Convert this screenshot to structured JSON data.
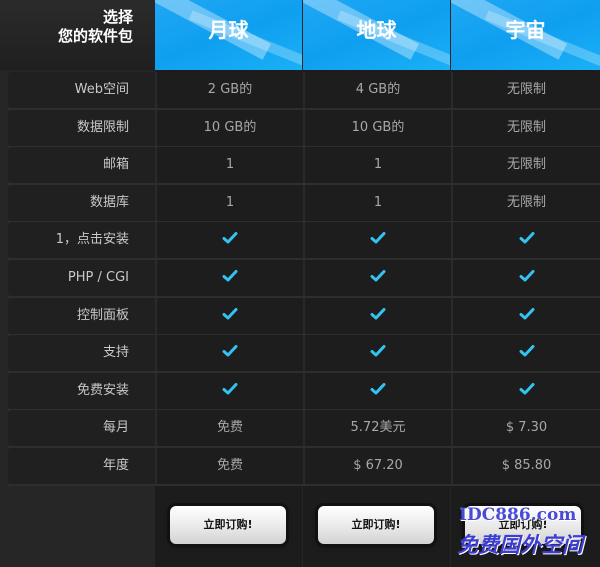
{
  "corner": {
    "line1": "选择",
    "line2": "您的软件包"
  },
  "plans": [
    {
      "name": "月球"
    },
    {
      "name": "地球"
    },
    {
      "name": "宇宙"
    }
  ],
  "rows": [
    {
      "label": "Web空间",
      "values": [
        "2 GB的",
        "4 GB的",
        "无限制"
      ]
    },
    {
      "label": "数据限制",
      "values": [
        "10 GB的",
        "10 GB的",
        "无限制"
      ]
    },
    {
      "label": "邮箱",
      "values": [
        "1",
        "1",
        "无限制"
      ]
    },
    {
      "label": "数据库",
      "values": [
        "1",
        "1",
        "无限制"
      ]
    },
    {
      "label": "1，点击安装",
      "values": [
        "check",
        "check",
        "check"
      ]
    },
    {
      "label": "PHP / CGI",
      "values": [
        "check",
        "check",
        "check"
      ]
    },
    {
      "label": "控制面板",
      "values": [
        "check",
        "check",
        "check"
      ]
    },
    {
      "label": "支持",
      "values": [
        "check",
        "check",
        "check"
      ]
    },
    {
      "label": "免费安装",
      "values": [
        "check",
        "check",
        "check"
      ]
    },
    {
      "label": "每月",
      "values": [
        "免费",
        "5.72美元",
        "$ 7.30"
      ]
    },
    {
      "label": "年度",
      "values": [
        "免费",
        "$ 67.20",
        "$ 85.80"
      ]
    }
  ],
  "buttons": {
    "order_label": "立即订购!"
  },
  "watermark": {
    "line1": "IDC886.com",
    "line2": "免费国外空间"
  },
  "colors": {
    "accent": "#1fa7f4",
    "check": "#33c3f0",
    "background": "#262626"
  },
  "icons": {
    "check": "check-icon"
  }
}
